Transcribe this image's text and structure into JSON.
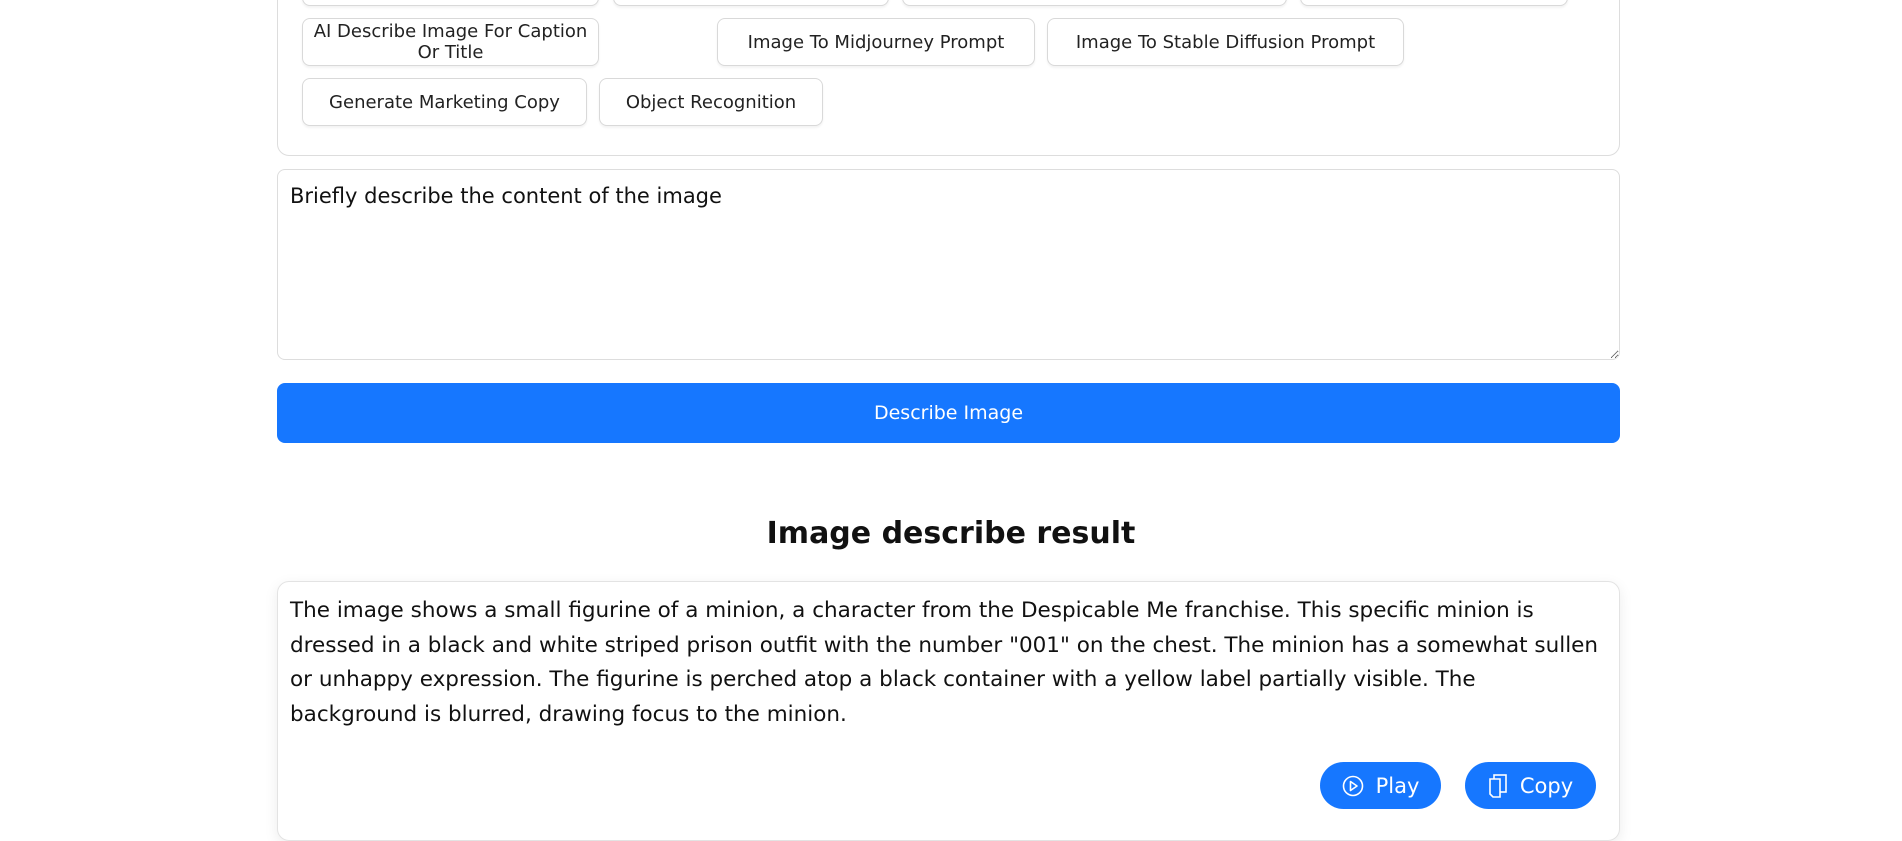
{
  "preset_buttons": [
    "AI Describe Image For Caption Or Title",
    "Image To Midjourney Prompt",
    "Image To Stable Diffusion Prompt",
    "Generate Marketing Copy",
    "Object Recognition"
  ],
  "prompt_input": {
    "value": "Briefly describe the content of the image"
  },
  "describe_button": "Describe Image",
  "result": {
    "heading": "Image describe result",
    "text": "The image shows a small figurine of a minion, a character from the Despicable Me franchise. This specific minion is dressed in a black and white striped prison outfit with the number \"001\" on the chest.  The minion has a somewhat sullen or unhappy expression. The figurine is perched atop a black container with a yellow label partially visible. The background is blurred, drawing focus to the minion.",
    "play_label": "Play",
    "copy_label": "Copy"
  },
  "colors": {
    "accent": "#1677ff"
  }
}
